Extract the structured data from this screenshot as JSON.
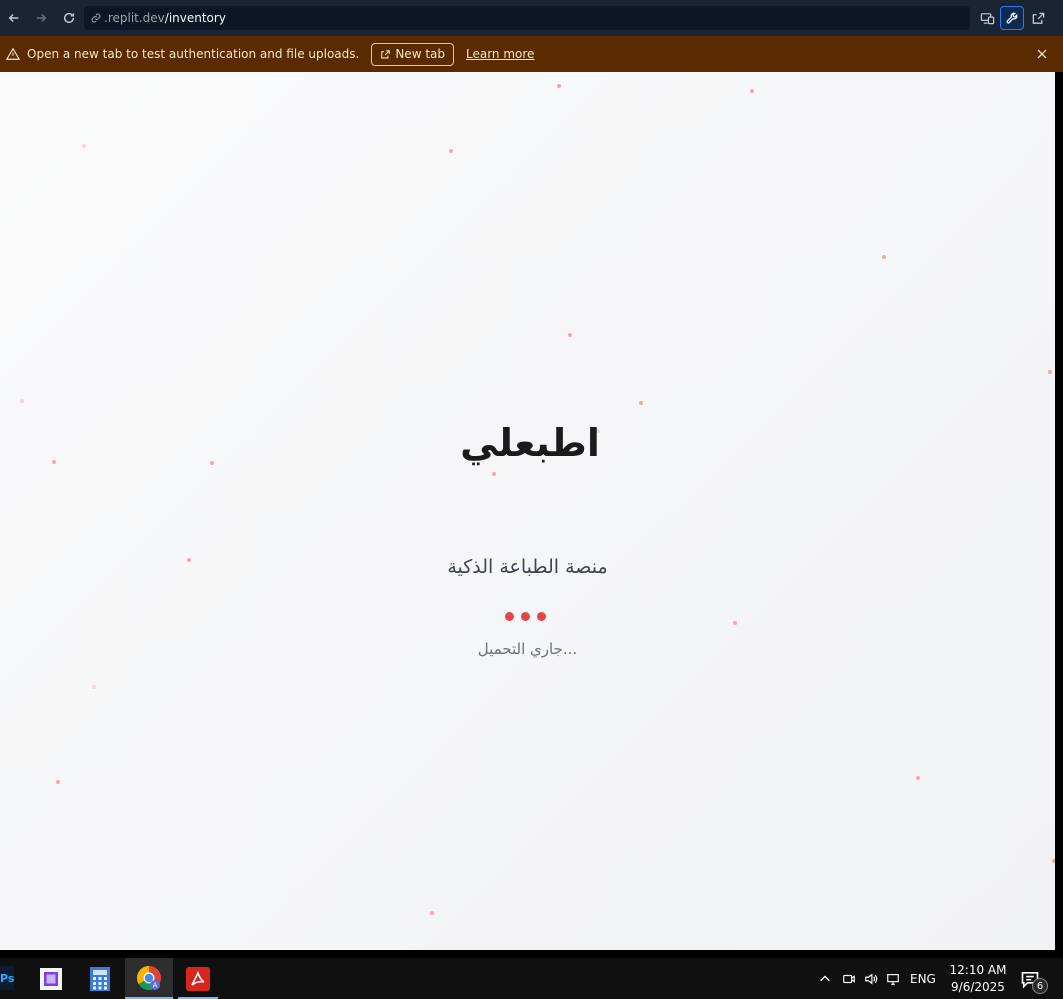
{
  "browser": {
    "url_host": ".replit.dev",
    "url_path": "/inventory"
  },
  "banner": {
    "message": "Open a new tab to test authentication and file uploads.",
    "new_tab_label": "New tab",
    "learn_more_label": "Learn more"
  },
  "app": {
    "logo_text": "اطبعلي",
    "tagline": "منصة الطباعة الذكية",
    "loading_text": "جاري التحميل...",
    "accent_color": "#e04848"
  },
  "taskbar": {
    "ps_label": "Ps",
    "language": "ENG",
    "time": "12:10 AM",
    "date": "9/6/2025",
    "notification_count": "6",
    "apps": [
      "photoshop-icon",
      "app-square-icon",
      "calculator-icon",
      "chrome-icon",
      "acrobat-icon"
    ]
  }
}
